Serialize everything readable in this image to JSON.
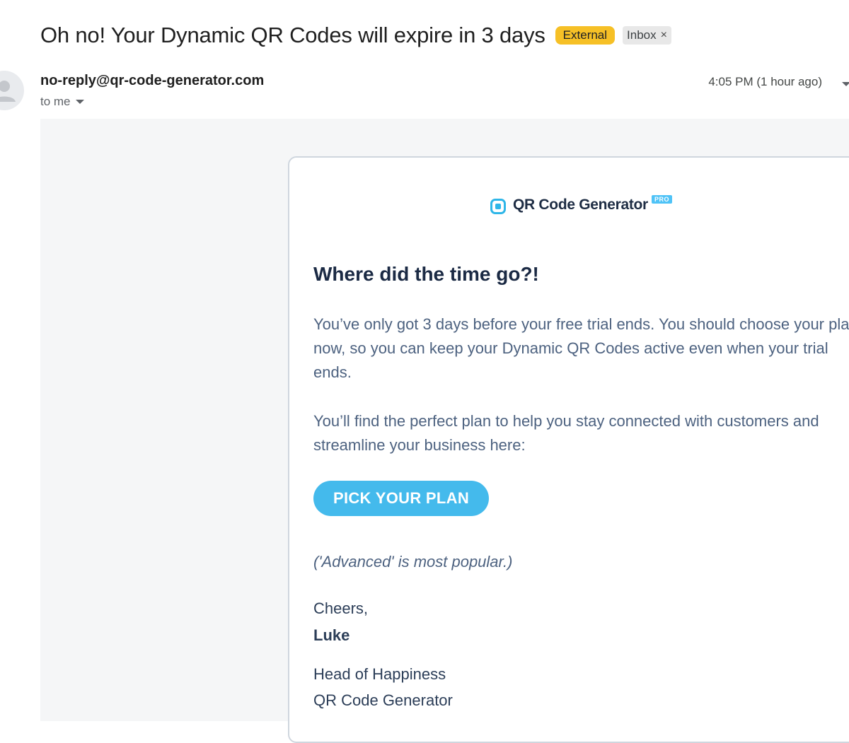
{
  "email": {
    "subject": "Oh no! Your Dynamic QR Codes will expire in 3 days",
    "labels": {
      "external": "External",
      "inbox": "Inbox",
      "inbox_remove": "×"
    },
    "sender": "no-reply@qr-code-generator.com",
    "recipient": "to me",
    "timestamp": "4:05 PM (1 hour ago)"
  },
  "body": {
    "logo": {
      "name": "QR Code Generator",
      "badge": "PRO"
    },
    "headline": "Where did the time go?!",
    "paragraph1": "You’ve only got 3 days before your free trial ends. You should choose your plan now, so you can keep your Dynamic QR Codes active even when your trial ends.",
    "paragraph2": "You’ll find the perfect plan to help you stay connected with customers and streamline your business here:",
    "cta_label": "PICK YOUR PLAN",
    "note": "('Advanced' is most popular.)",
    "sign_off": "Cheers,",
    "signer": "Luke",
    "role": "Head of Happiness",
    "company": "QR Code Generator"
  },
  "colors": {
    "external_badge": "#f6c026",
    "cta": "#44baec",
    "logo_accent": "#2eb6e8",
    "headline": "#1b2a44",
    "body_text": "#4d6280"
  },
  "icons": [
    "person-avatar-icon",
    "recipient-dropdown-icon",
    "more-options-icon",
    "qr-logo-icon"
  ]
}
